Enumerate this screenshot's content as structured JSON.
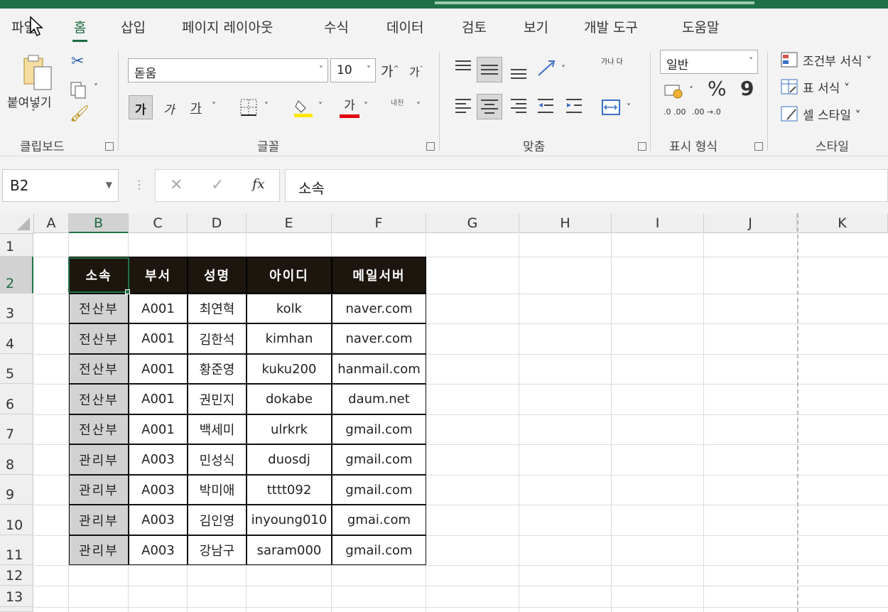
{
  "ribbon_tabs": [
    "파일",
    "홈",
    "삽입",
    "페이지 레이아웃",
    "수식",
    "데이터",
    "검토",
    "보기",
    "개발 도구",
    "도움말"
  ],
  "clipboard": {
    "paste": "붙여넣기",
    "group": "클립보드"
  },
  "font": {
    "name": "돋움",
    "size": "10",
    "grow": "가",
    "shrink": "가",
    "bold": "가",
    "italic": "가",
    "underline": "가",
    "color_letter": "가",
    "phonetic": "내천",
    "group": "글꼴"
  },
  "align": {
    "wrap": "가나 다",
    "group": "맞춤"
  },
  "number": {
    "format": "일반",
    "percent": "%",
    "comma": "9",
    "inc": ".0 .00",
    "dec": ".00 →.0",
    "group": "표시 형식"
  },
  "styles": {
    "conditional": "조건부 서식",
    "table": "표 서식",
    "cell": "셀 스타일",
    "group": "스타일"
  },
  "formula_bar": {
    "name_box": "B2",
    "value": "소속",
    "cancel": "✕",
    "enter": "✓",
    "fx": "fx"
  },
  "columns": [
    "A",
    "B",
    "C",
    "D",
    "E",
    "F",
    "G",
    "H",
    "I",
    "J",
    "K"
  ],
  "rows": [
    "1",
    "2",
    "3",
    "4",
    "5",
    "6",
    "7",
    "8",
    "9",
    "10",
    "11",
    "12",
    "13"
  ],
  "table": {
    "headers": [
      "소속",
      "부서",
      "성명",
      "아이디",
      "메일서버"
    ],
    "rows": [
      [
        "전산부",
        "A001",
        "최연혁",
        "kolk",
        "naver.com"
      ],
      [
        "전산부",
        "A001",
        "김한석",
        "kimhan",
        "naver.com"
      ],
      [
        "전산부",
        "A001",
        "황준영",
        "kuku200",
        "hanmail.com"
      ],
      [
        "전산부",
        "A001",
        "권민지",
        "dokabe",
        "daum.net"
      ],
      [
        "전산부",
        "A001",
        "백세미",
        "ulrkrk",
        "gmail.com"
      ],
      [
        "관리부",
        "A003",
        "민성식",
        "duosdj",
        "gmail.com"
      ],
      [
        "관리부",
        "A003",
        "박미애",
        "tttt092",
        "gmail.com"
      ],
      [
        "관리부",
        "A003",
        "김인영",
        "inyoung010",
        "gmai.com"
      ],
      [
        "관리부",
        "A003",
        "강남구",
        "saram000",
        "gmail.com"
      ]
    ]
  }
}
